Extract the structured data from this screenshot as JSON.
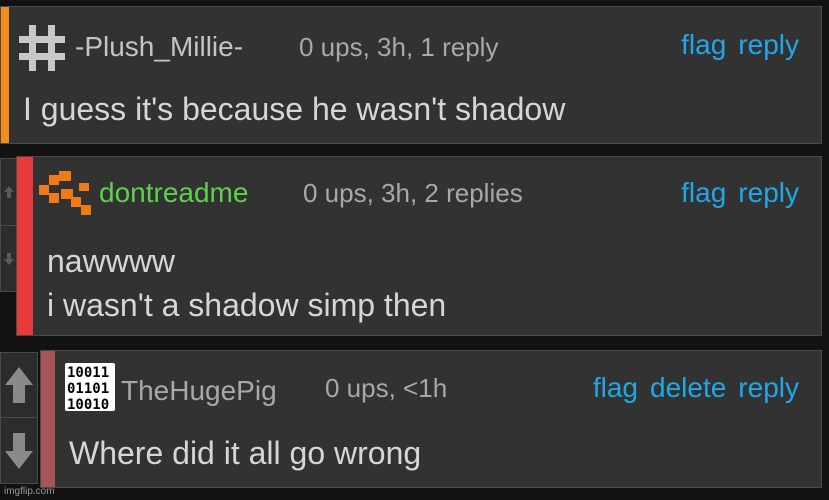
{
  "comments": [
    {
      "username": "-Plush_Millie-",
      "meta": "0 ups, 3h, 1 reply",
      "actions": [
        "flag",
        "reply"
      ],
      "body": [
        "I guess it's because he wasn't shadow"
      ],
      "accent_color": "#f28c1e",
      "avatar": "hash-icon"
    },
    {
      "username": "dontreadme",
      "meta": "0 ups, 3h, 2 replies",
      "actions": [
        "flag",
        "reply"
      ],
      "body": [
        "nawwww",
        "i wasn't a shadow simp then"
      ],
      "accent_color": "#e83a3a",
      "avatar": "orange-pixel-icon"
    },
    {
      "username": "TheHugePig",
      "meta": "0 ups, <1h",
      "actions": [
        "flag",
        "delete",
        "reply"
      ],
      "body": [
        "Where did it all go wrong"
      ],
      "accent_color": "#a85454",
      "avatar": "binary-icon",
      "avatar_text": [
        "10011",
        "01101",
        "10010"
      ]
    }
  ],
  "watermark": "imgflip.com",
  "colors": {
    "link": "#21a7e8",
    "background": "#121212",
    "card": "#323232",
    "username_green": "#5ed04d"
  }
}
